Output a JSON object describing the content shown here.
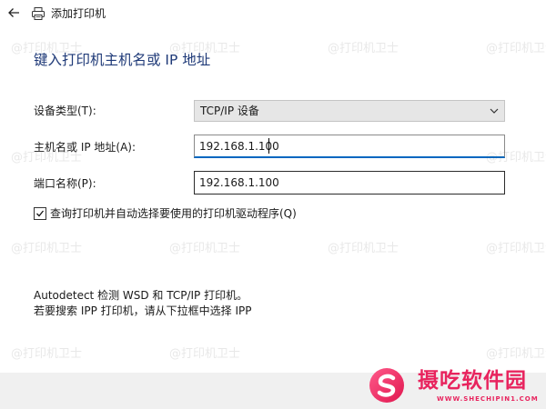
{
  "window": {
    "title": "添加打印机",
    "back_icon": "arrow-left-icon",
    "printer_icon": "printer-icon"
  },
  "heading": "键入打印机主机名或 IP 地址",
  "form": {
    "device_type": {
      "label": "设备类型(T):",
      "value": "TCP/IP 设备",
      "icon": "chevron-down-icon"
    },
    "host": {
      "label": "主机名或 IP 地址(A):",
      "value": "192.168.1.100"
    },
    "port": {
      "label": "端口名称(P):",
      "value": "192.168.1.100"
    },
    "query_checkbox": {
      "label": "查询打印机并自动选择要使用的打印机驱动程序(Q)",
      "checked": true
    }
  },
  "info": {
    "line1": "Autodetect 检测 WSD 和 TCP/IP 打印机。",
    "line2": "若要搜索 IPP 打印机，请从下拉框中选择 IPP"
  },
  "watermark": "@打印机卫士",
  "logo": {
    "name": "摄吃软件园",
    "url": "WWW.SHECHIPIN1.COM",
    "color": "#e8245e"
  }
}
